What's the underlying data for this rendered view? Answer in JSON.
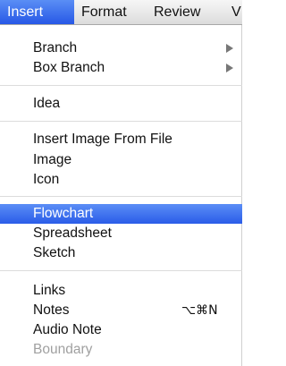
{
  "menubar": {
    "items": [
      {
        "label": "Insert"
      },
      {
        "label": "Format"
      },
      {
        "label": "Review"
      },
      {
        "label": "V"
      }
    ]
  },
  "menu": {
    "branch": {
      "label": "Branch",
      "icon": "chevron-right-icon"
    },
    "box_branch": {
      "label": "Box Branch",
      "icon": "chevron-right-icon"
    },
    "idea": {
      "label": "Idea"
    },
    "insert_image_from_file": {
      "label": "Insert Image From File"
    },
    "image": {
      "label": "Image"
    },
    "icon": {
      "label": "Icon"
    },
    "flowchart": {
      "label": "Flowchart",
      "highlighted": true
    },
    "spreadsheet": {
      "label": "Spreadsheet"
    },
    "sketch": {
      "label": "Sketch"
    },
    "links": {
      "label": "Links"
    },
    "notes": {
      "label": "Notes",
      "shortcut": "⌥⌘N"
    },
    "audio_note": {
      "label": "Audio Note"
    },
    "boundary": {
      "label": "Boundary",
      "disabled": true
    }
  },
  "colors": {
    "highlight": "#2a5ce8",
    "disabled_text": "#a0a0a0"
  }
}
